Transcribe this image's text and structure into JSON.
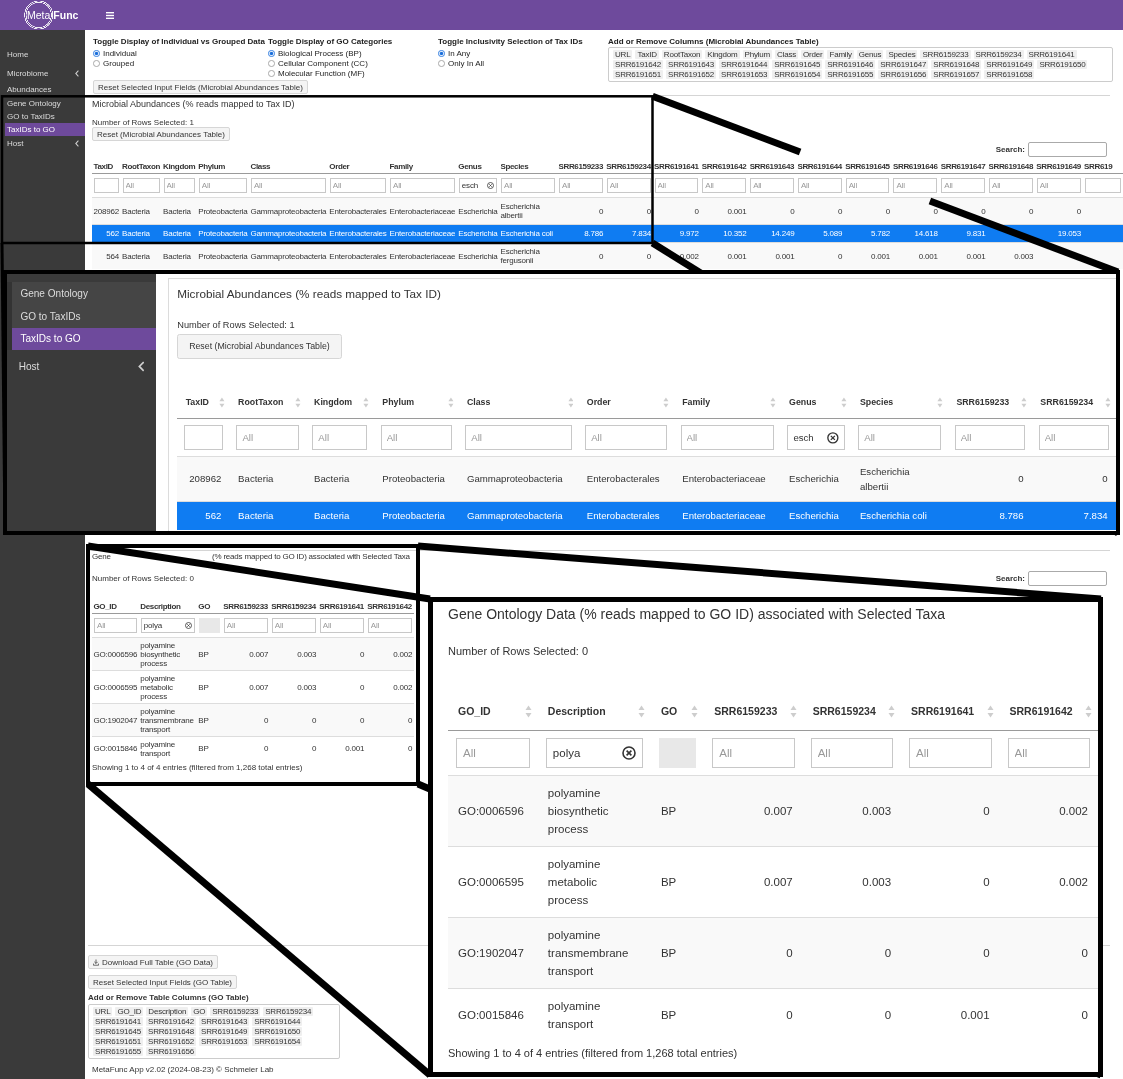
{
  "header": {
    "logo": "Meta**Func**"
  },
  "sidebar": {
    "items": [
      {
        "label": "Home",
        "kind": "link",
        "selected": false
      },
      {
        "label": "Microbiome",
        "kind": "group",
        "selected": false,
        "children": [
          {
            "label": "Abundances",
            "selected": false
          },
          {
            "label": "Gene Ontology",
            "selected": false
          },
          {
            "label": "GO to TaxIDs",
            "selected": false
          },
          {
            "label": "TaxIDs to GO",
            "selected": true
          }
        ]
      },
      {
        "label": "Host",
        "kind": "group",
        "selected": false
      }
    ]
  },
  "controls": {
    "groups": [
      {
        "title": "Toggle Display of Individual vs Grouped Data",
        "options": [
          {
            "label": "Individual",
            "selected": true
          },
          {
            "label": "Grouped",
            "selected": false
          }
        ],
        "button": "Reset Selected Input Fields (Microbial Abundances Table)"
      },
      {
        "title": "Toggle Display of GO Categories",
        "options": [
          {
            "label": "Biological Process (BP)",
            "selected": true
          },
          {
            "label": "Cellular Component (CC)",
            "selected": false
          },
          {
            "label": "Molecular Function (MF)",
            "selected": false
          }
        ]
      },
      {
        "title": "Toggle Inclusivity Selection of Tax IDs",
        "options": [
          {
            "label": "In Any",
            "selected": true
          },
          {
            "label": "Only In All",
            "selected": false
          }
        ]
      }
    ],
    "column_picker": {
      "title": "Add or Remove Columns (Microbial Abundances Table)",
      "tags": [
        "URL",
        "TaxID",
        "RootTaxon",
        "Kingdom",
        "Phylum",
        "Class",
        "Order",
        "Family",
        "Genus",
        "Species",
        "SRR6159233",
        "SRR6159234",
        "SRR6191641",
        "SRR6191642",
        "SRR6191643",
        "SRR6191644",
        "SRR6191645",
        "SRR6191646",
        "SRR6191647",
        "SRR6191648",
        "SRR6191649",
        "SRR6191650",
        "SRR6191651",
        "SRR6191652",
        "SRR6191653",
        "SRR6191654",
        "SRR6191655",
        "SRR6191656",
        "SRR6191657",
        "SRR6191658"
      ]
    }
  },
  "abundances_table": {
    "title": "Microbial Abundances (% reads mapped to Tax ID)",
    "rows_selected": "Number of Rows Selected: 1",
    "reset_button": "Reset (Microbial Abundances Table)",
    "search_label": "Search:",
    "columns": [
      {
        "label": "TaxID",
        "kind": "id"
      },
      {
        "label": "RootTaxon",
        "kind": "text"
      },
      {
        "label": "Kingdom",
        "kind": "text"
      },
      {
        "label": "Phylum",
        "kind": "text"
      },
      {
        "label": "Class",
        "kind": "text"
      },
      {
        "label": "Order",
        "kind": "text"
      },
      {
        "label": "Family",
        "kind": "text"
      },
      {
        "label": "Genus",
        "kind": "text"
      },
      {
        "label": "Species",
        "kind": "paragraph"
      },
      {
        "label": "SRR6159233",
        "kind": "number"
      },
      {
        "label": "SRR6159234",
        "kind": "number"
      },
      {
        "label": "SRR6191641",
        "kind": "number"
      },
      {
        "label": "SRR6191642",
        "kind": "number"
      },
      {
        "label": "SRR6191643",
        "kind": "number"
      },
      {
        "label": "SRR6191644",
        "kind": "number"
      },
      {
        "label": "SRR6191645",
        "kind": "number"
      },
      {
        "label": "SRR6191646",
        "kind": "number"
      },
      {
        "label": "SRR6191647",
        "kind": "number"
      },
      {
        "label": "SRR6191648",
        "kind": "number"
      },
      {
        "label": "SRR6191649",
        "kind": "number"
      },
      {
        "label": "SRR619",
        "kind": "number"
      }
    ],
    "filters": [
      {
        "disabled": false
      },
      {
        "placeholder": "All",
        "disabled": false
      },
      {
        "placeholder": "All",
        "disabled": false
      },
      {
        "placeholder": "All",
        "disabled": false
      },
      {
        "placeholder": "All",
        "disabled": false
      },
      {
        "placeholder": "All",
        "disabled": false
      },
      {
        "placeholder": "All",
        "disabled": false
      },
      {
        "value": "esch",
        "disabled": false
      },
      {
        "placeholder": "All",
        "disabled": false
      },
      {
        "placeholder": "All",
        "disabled": false
      },
      {
        "placeholder": "All",
        "disabled": false
      },
      {
        "placeholder": "All",
        "disabled": false
      },
      {
        "placeholder": "All",
        "disabled": false
      },
      {
        "placeholder": "All",
        "disabled": false
      },
      {
        "placeholder": "All",
        "disabled": false
      },
      {
        "placeholder": "All",
        "disabled": false
      },
      {
        "placeholder": "All",
        "disabled": false
      },
      {
        "placeholder": "All",
        "disabled": false
      },
      {
        "placeholder": "All",
        "disabled": false
      },
      {
        "placeholder": "All",
        "disabled": false
      },
      {
        "disabled": false
      }
    ],
    "rows": [
      {
        "selected": false,
        "cells": [
          "208962",
          "Bacteria",
          "Bacteria",
          "Proteobacteria",
          "Gammaproteobacteria",
          "Enterobacterales",
          "Enterobacteriaceae",
          "Escherichia",
          "Escherichia albertii",
          "0",
          "0",
          "0",
          "0.001",
          "0",
          "0",
          "0",
          "0",
          "0",
          "0",
          "0",
          null
        ]
      },
      {
        "selected": true,
        "cells": [
          "562",
          "Bacteria",
          "Bacteria",
          "Proteobacteria",
          "Gammaproteobacteria",
          "Enterobacterales",
          "Enterobacteriaceae",
          "Escherichia",
          "Escherichia coli",
          "8.786",
          "7.834",
          "9.972",
          "10.352",
          "14.249",
          "5.089",
          "5.782",
          "14.618",
          "9.831",
          null,
          "19.053",
          null
        ]
      },
      {
        "selected": false,
        "cells": [
          "564",
          "Bacteria",
          "Bacteria",
          "Proteobacteria",
          "Gammaproteobacteria",
          "Enterobacterales",
          "Enterobacteriaceae",
          "Escherichia",
          "Escherichia fergusonii",
          "0",
          "0",
          "0.002",
          "0.001",
          "0.001",
          "0",
          "0.001",
          "0.001",
          "0.001",
          "0.003",
          null,
          null
        ]
      }
    ]
  },
  "go_table": {
    "title_fragments": [
      "Gene",
      "(% reads mapped to GO ID) associated with Selected Taxa"
    ],
    "rows_selected": "Number of Rows Selected: 0",
    "search_label": "Search:",
    "columns": [
      {
        "label": "GO_ID",
        "kind": "text"
      },
      {
        "label": "Description",
        "kind": "paragraph"
      },
      {
        "label": "GO",
        "kind": "text"
      },
      {
        "label": "SRR6159233",
        "kind": "number"
      },
      {
        "label": "SRR6159234",
        "kind": "number"
      },
      {
        "label": "SRR6191641",
        "kind": "number"
      },
      {
        "label": "SRR6191642",
        "kind": "number"
      }
    ],
    "filters": [
      {
        "placeholder": "All",
        "disabled": false
      },
      {
        "value": "polya",
        "disabled": false
      },
      {
        "disabled": true
      },
      {
        "placeholder": "All",
        "disabled": false
      },
      {
        "placeholder": "All",
        "disabled": false
      },
      {
        "placeholder": "All",
        "disabled": false
      },
      {
        "placeholder": "All",
        "disabled": false
      }
    ],
    "rows": [
      {
        "selected": false,
        "cells": [
          "GO:0006596",
          "polyamine biosynthetic process",
          "BP",
          "0.007",
          "0.003",
          "0",
          "0.002"
        ]
      },
      {
        "selected": false,
        "cells": [
          "GO:0006595",
          "polyamine metabolic process",
          "BP",
          "0.007",
          "0.003",
          "0",
          "0.002"
        ]
      },
      {
        "selected": false,
        "cells": [
          "GO:1902047",
          "polyamine transmembrane transport",
          "BP",
          "0",
          "0",
          "0",
          "0"
        ]
      },
      {
        "selected": false,
        "cells": [
          "GO:0015846",
          "polyamine transport",
          "BP",
          "0",
          "0",
          "0.001",
          "0"
        ]
      }
    ],
    "footer": "Showing 1 to 4 of 4 entries (filtered from 1,268 total entries)"
  },
  "go_actions": {
    "download_button": "Download Full Table (GO Data)",
    "reset_button": "Reset Selected Input Fields (GO Table)",
    "column_picker": {
      "title": "Add or Remove Table Columns (GO Table)",
      "tags": [
        "URL",
        "GO_ID",
        "Description",
        "GO",
        "SRR6159233",
        "SRR6159234",
        "SRR6191641",
        "SRR6191642",
        "SRR6191643",
        "SRR6191644",
        "SRR6191645",
        "SRR6191648",
        "SRR6191649",
        "SRR6191650",
        "SRR6191651",
        "SRR6191652",
        "SRR6191653",
        "SRR6191654",
        "SRR6191655",
        "SRR6191656"
      ]
    }
  },
  "footer": "MetaFunc App v2.02 (2024-08-23) © Schmeier Lab",
  "inset_1": {
    "sidebar": {
      "submenu_items": [
        {
          "label": "Gene Ontology",
          "selected": false
        },
        {
          "label": "GO to TaxIDs",
          "selected": false
        },
        {
          "label": "TaxIDs to GO",
          "selected": true
        }
      ],
      "items": [
        {
          "label": "Host",
          "kind": "group",
          "selected": false
        }
      ]
    },
    "table": {
      "title": "Microbial Abundances (% reads mapped to Tax ID)",
      "rows_selected": "Number of Rows Selected: 1",
      "reset_button": "Reset (Microbial Abundances Table)",
      "columns": [
        {
          "label": "TaxID",
          "kind": "id"
        },
        {
          "label": "RootTaxon",
          "kind": "text"
        },
        {
          "label": "Kingdom",
          "kind": "text"
        },
        {
          "label": "Phylum",
          "kind": "text"
        },
        {
          "label": "Class",
          "kind": "text"
        },
        {
          "label": "Order",
          "kind": "text"
        },
        {
          "label": "Family",
          "kind": "text"
        },
        {
          "label": "Genus",
          "kind": "text"
        },
        {
          "label": "Species",
          "kind": "paragraph"
        },
        {
          "label": "SRR6159233",
          "kind": "number"
        },
        {
          "label": "SRR6159234",
          "kind": "number"
        }
      ],
      "filters": [
        {
          "disabled": false
        },
        {
          "placeholder": "All",
          "disabled": false
        },
        {
          "placeholder": "All",
          "disabled": false
        },
        {
          "placeholder": "All",
          "disabled": false
        },
        {
          "placeholder": "All",
          "disabled": false
        },
        {
          "placeholder": "All",
          "disabled": false
        },
        {
          "placeholder": "All",
          "disabled": false
        },
        {
          "value": "esch",
          "disabled": false
        },
        {
          "placeholder": "All",
          "disabled": false
        },
        {
          "placeholder": "All",
          "disabled": false
        },
        {
          "placeholder": "All",
          "disabled": false
        }
      ],
      "rows": [
        {
          "selected": false,
          "cells": [
            "208962",
            "Bacteria",
            "Bacteria",
            "Proteobacteria",
            "Gammaproteobacteria",
            "Enterobacterales",
            "Enterobacteriaceae",
            "Escherichia",
            "Escherichia albertii",
            "0",
            "0"
          ]
        },
        {
          "selected": true,
          "cells": [
            "562",
            "Bacteria",
            "Bacteria",
            "Proteobacteria",
            "Gammaproteobacteria",
            "Enterobacterales",
            "Enterobacteriaceae",
            "Escherichia",
            "Escherichia coli",
            "8.786",
            "7.834"
          ]
        }
      ]
    }
  },
  "inset_2": {
    "table": {
      "title": "Gene Ontology Data (% reads mapped to GO ID) associated with Selected Taxa",
      "rows_selected": "Number of Rows Selected: 0",
      "columns": [
        {
          "label": "GO_ID",
          "kind": "text"
        },
        {
          "label": "Description",
          "kind": "paragraph"
        },
        {
          "label": "GO",
          "kind": "text"
        },
        {
          "label": "SRR6159233",
          "kind": "number"
        },
        {
          "label": "SRR6159234",
          "kind": "number"
        },
        {
          "label": "SRR6191641",
          "kind": "number"
        },
        {
          "label": "SRR6191642",
          "kind": "number"
        }
      ],
      "filters": [
        {
          "placeholder": "All",
          "disabled": false
        },
        {
          "value": "polya",
          "disabled": false
        },
        {
          "disabled": true
        },
        {
          "placeholder": "All",
          "disabled": false
        },
        {
          "placeholder": "All",
          "disabled": false
        },
        {
          "placeholder": "All",
          "disabled": false
        },
        {
          "placeholder": "All",
          "disabled": false
        }
      ],
      "rows": [
        {
          "selected": false,
          "cells": [
            "GO:0006596",
            "polyamine biosynthetic process",
            "BP",
            "0.007",
            "0.003",
            "0",
            "0.002"
          ]
        },
        {
          "selected": false,
          "cells": [
            "GO:0006595",
            "polyamine metabolic process",
            "BP",
            "0.007",
            "0.003",
            "0",
            "0.002"
          ]
        },
        {
          "selected": false,
          "cells": [
            "GO:1902047",
            "polyamine transmembrane transport",
            "BP",
            "0",
            "0",
            "0",
            "0"
          ]
        },
        {
          "selected": false,
          "cells": [
            "GO:0015846",
            "polyamine transport",
            "BP",
            "0",
            "0",
            "0.001",
            "0"
          ]
        }
      ],
      "footer": "Showing 1 to 4 of 4 entries (filtered from 1,268 total entries)"
    }
  }
}
